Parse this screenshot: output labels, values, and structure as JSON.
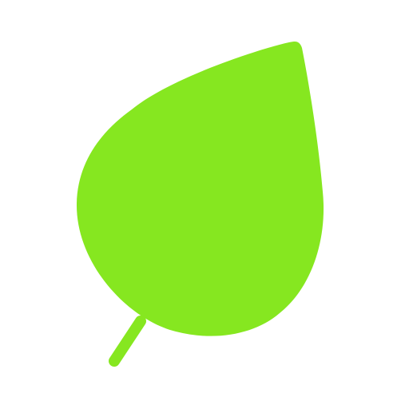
{
  "icon": {
    "name": "leaf-icon",
    "color": "#86E720",
    "background": "#FFFFFF"
  }
}
